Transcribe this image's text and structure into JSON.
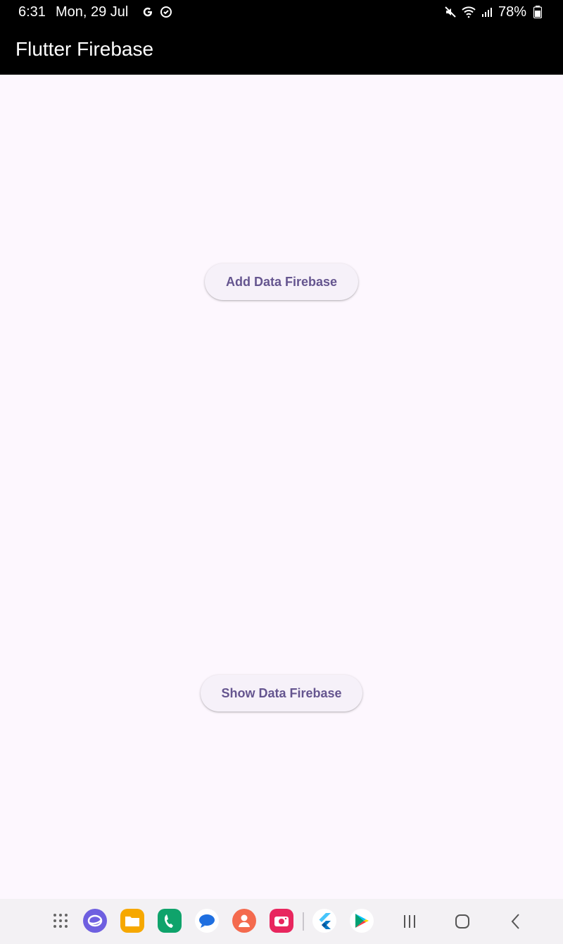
{
  "status_bar": {
    "time": "6:31",
    "date": "Mon, 29 Jul",
    "battery": "78%",
    "left_icons": [
      "google-icon",
      "sync-icon"
    ],
    "right_icons": [
      "mute-icon",
      "wifi-icon",
      "signal-icon",
      "battery-icon"
    ]
  },
  "app_bar": {
    "title": "Flutter Firebase"
  },
  "main": {
    "add_button_label": "Add Data Firebase",
    "show_button_label": "Show Data Firebase"
  },
  "dock": {
    "apps": [
      "app-drawer-icon",
      "browser-icon",
      "files-icon",
      "phone-icon",
      "messages-icon",
      "contacts-icon",
      "camera-icon",
      "flutter-icon",
      "play-store-icon"
    ],
    "system": [
      "recents-icon",
      "home-icon",
      "back-icon"
    ]
  },
  "colors": {
    "background": "#fdf7fe",
    "appbar": "#000000",
    "button_bg": "#f6f1f9",
    "button_text": "#65558f"
  }
}
